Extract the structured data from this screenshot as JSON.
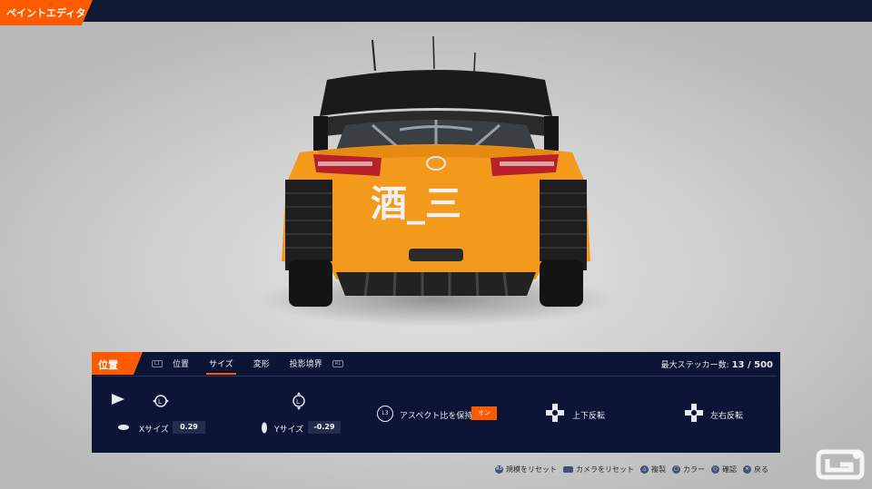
{
  "app": {
    "title": "ペイントエディタ"
  },
  "panel": {
    "section": "位置",
    "tabs": {
      "lb_hint": "L1",
      "rb_hint": "R1",
      "items": [
        "位置",
        "サイズ",
        "変形",
        "投影境界"
      ],
      "active_index": 1
    },
    "sticker_count_label": "最大ステッカー数:",
    "sticker_count_value": "13 / 500",
    "controls": {
      "x_size_label": "Xサイズ",
      "x_size_value": "0.29",
      "y_size_label": "Yサイズ",
      "y_size_value": "-0.29",
      "l3_label": "L3",
      "aspect_label": "アスペクト比を保持",
      "aspect_value": "オン",
      "flip_vertical_label": "上下反転",
      "flip_horizontal_label": "左右反転"
    }
  },
  "car": {
    "sticker_text": "酒_三",
    "body_color": "#f39a1c"
  },
  "footer": {
    "reset_scale": "規模をリセット",
    "reset_camera": "カメラをリセット",
    "copy": "複製",
    "color": "カラー",
    "confirm": "確認",
    "back": "戻る"
  },
  "colors": {
    "accent": "#ff5a00",
    "panel_bg": "#0c1535",
    "topbar": "#111a33"
  }
}
